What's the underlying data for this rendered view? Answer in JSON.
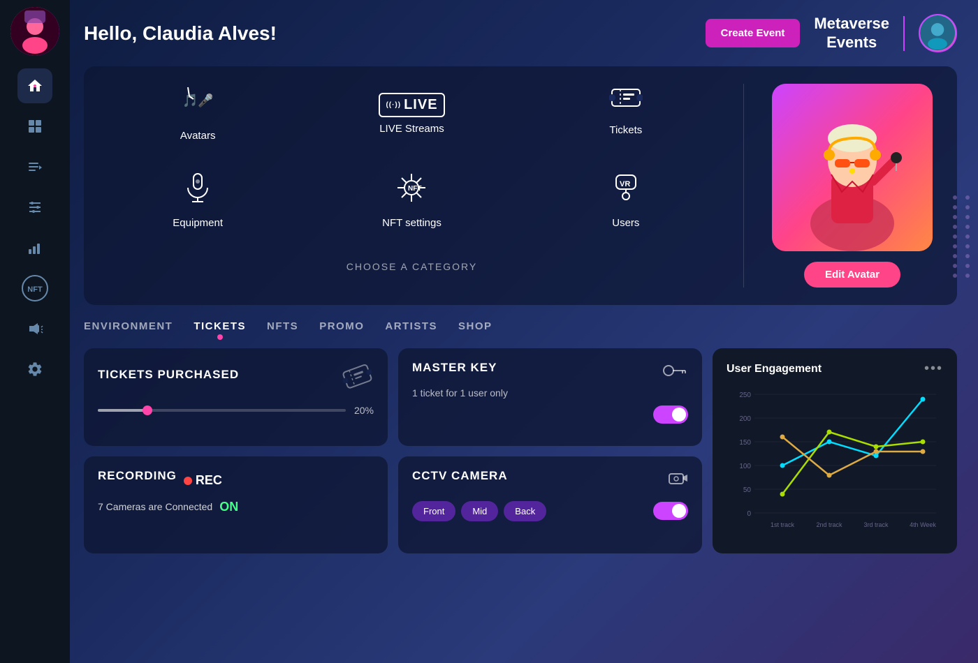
{
  "header": {
    "greeting": "Hello, Claudia Alves!",
    "create_event_label": "Create Event",
    "metaverse_label": "Metaverse\nEvents"
  },
  "sidebar": {
    "icons": [
      {
        "name": "home-icon",
        "symbol": "🏠",
        "active": true
      },
      {
        "name": "grid-icon",
        "symbol": "⊞",
        "active": false
      },
      {
        "name": "playlist-icon",
        "symbol": "≡▶",
        "active": false
      },
      {
        "name": "filter-icon",
        "symbol": "⚙",
        "active": false
      },
      {
        "name": "analytics-icon",
        "symbol": "📊",
        "active": false
      },
      {
        "name": "nft-icon",
        "symbol": "NFT",
        "active": false
      },
      {
        "name": "megaphone-icon",
        "symbol": "📢",
        "active": false
      },
      {
        "name": "settings-icon",
        "symbol": "⚙",
        "active": false
      }
    ]
  },
  "categories": [
    {
      "name": "avatars",
      "label": "Avatars",
      "icon": "🎵🎤"
    },
    {
      "name": "live-streams",
      "label": "LIVE Streams",
      "icon": "LIVE"
    },
    {
      "name": "tickets",
      "label": "Tickets",
      "icon": "🎟"
    },
    {
      "name": "equipment",
      "label": "Equipment",
      "icon": "🎙"
    },
    {
      "name": "nft-settings",
      "label": "NFT settings",
      "icon": "NFT"
    },
    {
      "name": "users",
      "label": "Users",
      "icon": "VR"
    }
  ],
  "choose_label": "CHOOSE A CATEGORY",
  "edit_avatar_label": "Edit Avatar",
  "tabs": [
    {
      "name": "environment",
      "label": "ENVIRONMENT",
      "active": false
    },
    {
      "name": "tickets",
      "label": "TICKETS",
      "active": true
    },
    {
      "name": "nfts",
      "label": "NFTS",
      "active": false
    },
    {
      "name": "promo",
      "label": "PROMO",
      "active": false
    },
    {
      "name": "artists",
      "label": "ARTISTS",
      "active": false
    },
    {
      "name": "shop",
      "label": "SHOP",
      "active": false
    }
  ],
  "cards": {
    "tickets_purchased": {
      "title": "TICKETS PURCHASED",
      "percentage": "20%"
    },
    "master_key": {
      "title": "MASTER KEY",
      "subtitle": "1 ticket for 1 user only",
      "toggle_on": true
    },
    "recording": {
      "title": "RECORDING",
      "rec_label": "REC",
      "cameras_label": "7 Cameras are Connected",
      "status_label": "ON"
    },
    "cctv": {
      "title": "CCTV CAMERA",
      "buttons": [
        "Front",
        "Mid",
        "Back"
      ],
      "toggle_on": true
    }
  },
  "engagement": {
    "title": "User Engagement",
    "more_label": "•••",
    "x_labels": [
      "1st track",
      "2nd track",
      "3rd track",
      "4th Week"
    ],
    "y_labels": [
      "250",
      "200",
      "150",
      "100",
      "50",
      "0"
    ],
    "series": [
      {
        "color": "#00ddff",
        "points": [
          100,
          150,
          120,
          240
        ]
      },
      {
        "color": "#aadd00",
        "points": [
          40,
          170,
          140,
          150
        ]
      },
      {
        "color": "#ddaa44",
        "points": [
          160,
          80,
          130,
          130
        ]
      }
    ]
  }
}
